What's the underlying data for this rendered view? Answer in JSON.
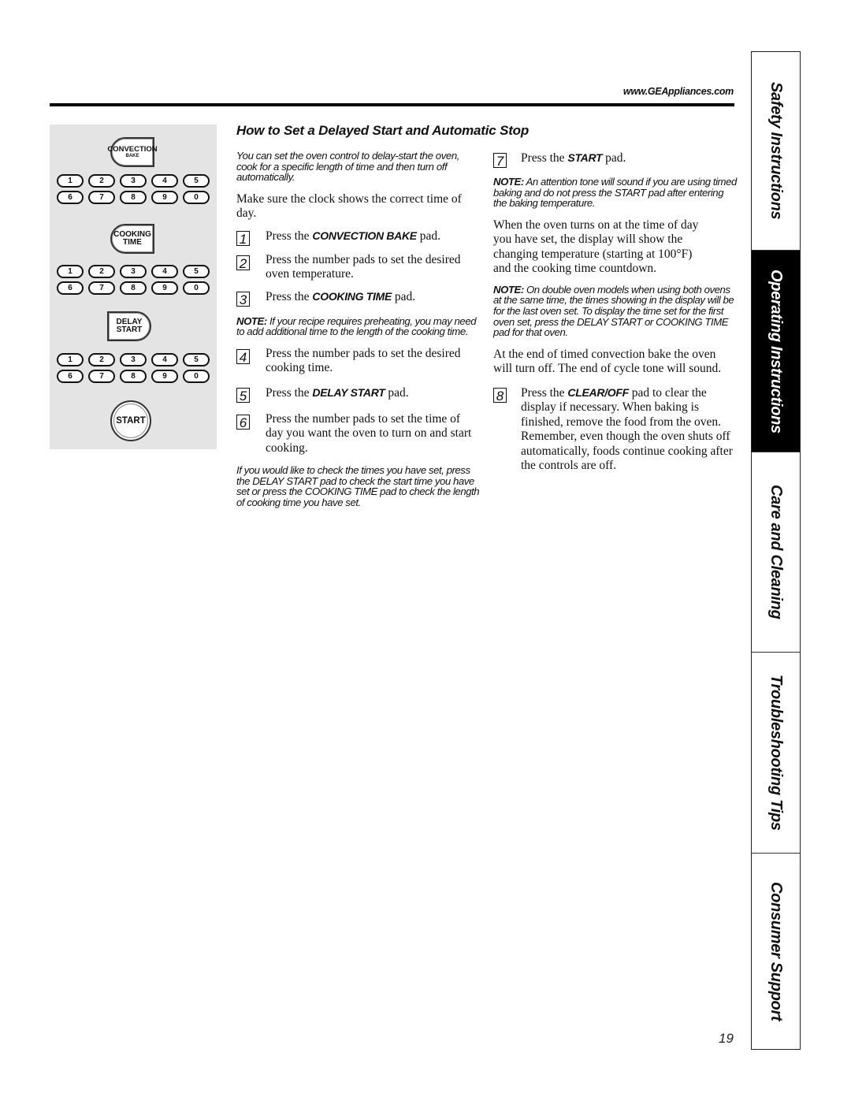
{
  "header": {
    "url": "www.GEAppliances.com"
  },
  "keypad": {
    "convection_bake": {
      "line1": "CONVECTION",
      "line2": "BAKE"
    },
    "cooking_time": {
      "line1": "COOKING",
      "line2": "TIME"
    },
    "delay_start": {
      "line1": "DELAY",
      "line2": "START"
    },
    "start": "START",
    "digits": [
      "1",
      "2",
      "3",
      "4",
      "5",
      "6",
      "7",
      "8",
      "9",
      "0"
    ]
  },
  "section": {
    "title": "How to Set a Delayed Start and Automatic Stop",
    "intro": "You can set the oven control to delay-start the oven, cook for a specific length of time and then turn off automatically.",
    "clock_note": "Make sure the clock shows the correct time of day.",
    "steps": [
      {
        "num": "1",
        "pre": "Press the ",
        "kw": "CONVECTION BAKE",
        "post": " pad."
      },
      {
        "num": "2",
        "pre": "Press the number pads to set the desired oven temperature.",
        "kw": "",
        "post": ""
      },
      {
        "num": "3",
        "pre": "Press the ",
        "kw": "COOKING TIME",
        "post": " pad."
      },
      {
        "num": "4",
        "pre": "Press the number pads to set the desired cooking time.",
        "kw": "",
        "post": ""
      },
      {
        "num": "5",
        "pre": "Press the ",
        "kw": "DELAY START",
        "post": " pad."
      },
      {
        "num": "6",
        "pre": "Press the number pads to set the time of day you want the oven to turn on and start cooking.",
        "kw": "",
        "post": ""
      },
      {
        "num": "7",
        "pre": "Press the ",
        "kw": "START",
        "post": " pad."
      },
      {
        "num": "8",
        "pre": "Press the ",
        "kw": "CLEAR/OFF",
        "post": " pad to clear the display if necessary. When baking is finished, remove the food from the oven. Remember, even though the oven shuts off automatically, foods continue cooking after the controls are off."
      }
    ],
    "note_preheat": {
      "label": "NOTE:",
      "text": " If your recipe requires preheating, you may need to add additional time to the length of the cooking time."
    },
    "check_times": "If you would like to check the times you have set, press the DELAY START pad to check the start time you have set or press the COOKING TIME pad to check the length of cooking time you have set.",
    "note_tone": {
      "label": "NOTE:",
      "text": " An attention tone will sound if you are using timed baking and do not press the START pad after entering the baking temperature."
    },
    "oven_on": "When the oven turns on at the time of day you have set, the display will show the changing temperature (starting at 100°F) and the cooking time countdown.",
    "note_double": {
      "label": "NOTE:",
      "text": " On double oven models when using both ovens at the same time, the times showing in the display will be for the last oven set. To display the time set for the first oven set, press the DELAY START or COOKING TIME pad for that oven."
    },
    "end_of_bake": "At the end of timed convection bake the oven will turn off. The end of cycle tone will sound."
  },
  "tabs": [
    {
      "label": "Safety Instructions",
      "active": false
    },
    {
      "label": "Operating Instructions",
      "active": true
    },
    {
      "label": "Care and Cleaning",
      "active": false
    },
    {
      "label": "Troubleshooting Tips",
      "active": false
    },
    {
      "label": "Consumer Support",
      "active": false
    }
  ],
  "footer": {
    "page_number": "19"
  }
}
